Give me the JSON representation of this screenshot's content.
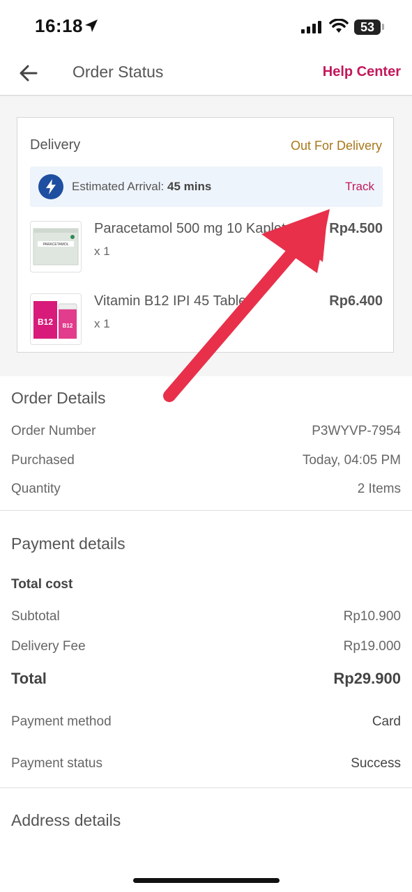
{
  "status_bar": {
    "time": "16:18",
    "battery": "53"
  },
  "header": {
    "title": "Order Status",
    "help": "Help Center"
  },
  "delivery": {
    "title": "Delivery",
    "status": "Out For Delivery",
    "eta_label": "Estimated Arrival:",
    "eta_value": "45 mins",
    "track": "Track",
    "items": [
      {
        "name": "Paracetamol 500 mg 10 Kaplet",
        "qty": "x 1",
        "price": "Rp4.500",
        "image_text": "PARACETAMOL"
      },
      {
        "name": "Vitamin B12 IPI 45 Tablet",
        "qty": "x 1",
        "price": "Rp6.400",
        "image_text": "B12 IPI"
      }
    ]
  },
  "order_details": {
    "title": "Order Details",
    "rows": [
      {
        "label": "Order Number",
        "value": "P3WYVP-7954"
      },
      {
        "label": "Purchased",
        "value": "Today, 04:05 PM"
      },
      {
        "label": "Quantity",
        "value": "2 Items"
      }
    ]
  },
  "payment": {
    "title": "Payment details",
    "total_cost_label": "Total cost",
    "subtotal": {
      "label": "Subtotal",
      "value": "Rp10.900"
    },
    "delivery_fee": {
      "label": "Delivery Fee",
      "value": "Rp19.000"
    },
    "total": {
      "label": "Total",
      "value": "Rp29.900"
    },
    "method": {
      "label": "Payment method",
      "value": "Card"
    },
    "status": {
      "label": "Payment status",
      "value": "Success"
    }
  },
  "address": {
    "title": "Address details"
  },
  "colors": {
    "accent": "#c2185b",
    "status": "#a8771a",
    "eta_bg": "#eef4fb",
    "bolt": "#1e4fa0",
    "arrow": "#e8304a"
  }
}
